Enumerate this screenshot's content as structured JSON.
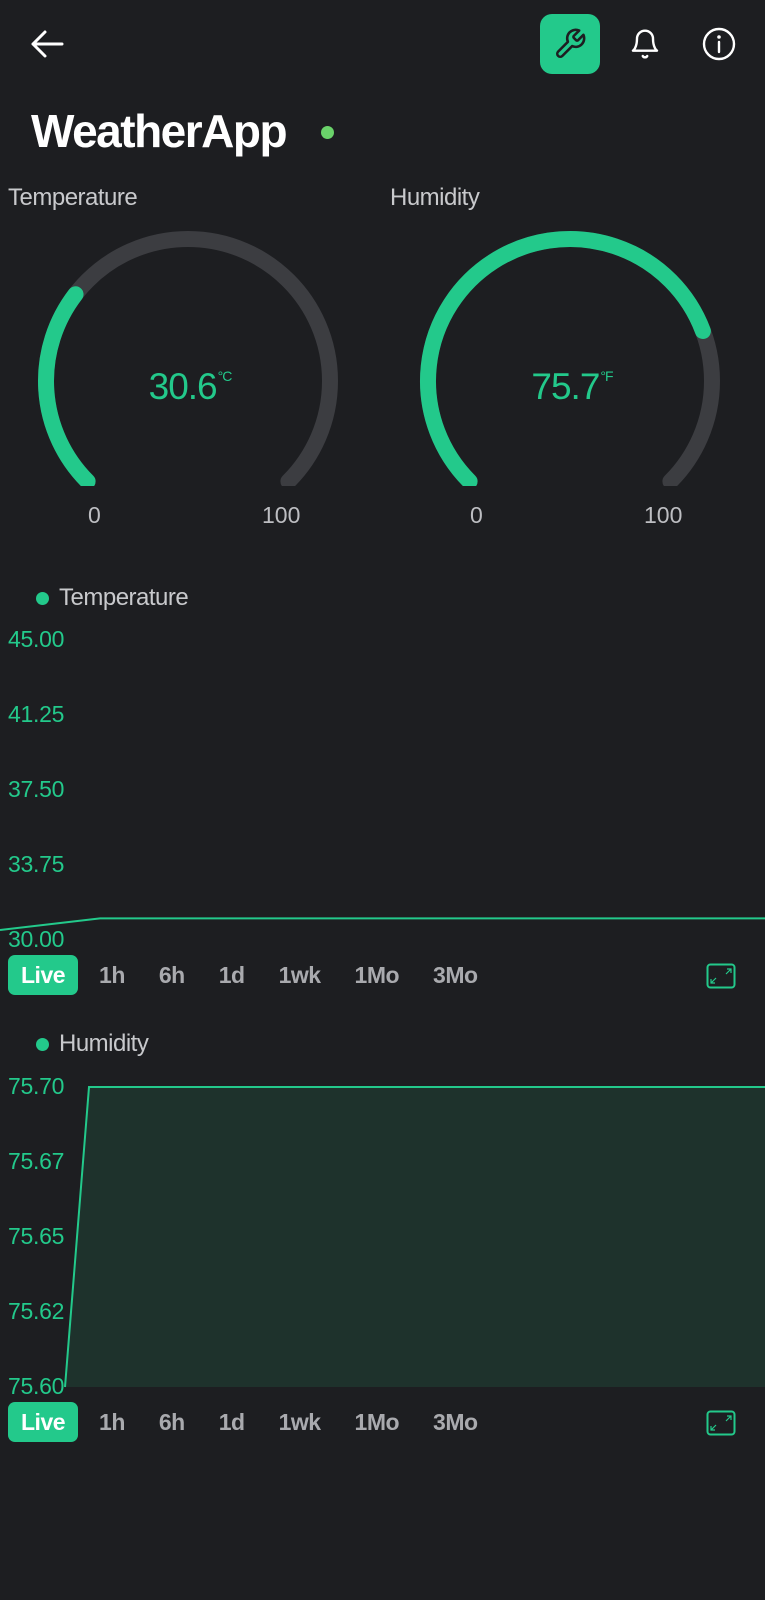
{
  "header": {
    "back_icon": "arrow-left-icon",
    "wrench_icon": "wrench-icon",
    "bell_icon": "bell-icon",
    "info_icon": "info-icon",
    "accent_color": "#23c98b"
  },
  "device": {
    "name": "WeatherApp",
    "status_color": "#6ad26a"
  },
  "gauges": [
    {
      "label": "Temperature",
      "value": "30.6",
      "unit": "°C",
      "min": "0",
      "max": "100",
      "fraction": 0.306
    },
    {
      "label": "Humidity",
      "value": "75.7",
      "unit": "°F",
      "min": "0",
      "max": "100",
      "fraction": 0.757
    }
  ],
  "charts": [
    {
      "legend": "Temperature",
      "y_ticks": [
        "45.00",
        "41.25",
        "37.50",
        "33.75",
        "30.00"
      ],
      "ylim": [
        30.0,
        45.0
      ],
      "series_values": [
        30.0,
        30.6,
        30.6
      ],
      "ranges": [
        "Live",
        "1h",
        "6h",
        "1d",
        "1wk",
        "1Mo",
        "3Mo"
      ],
      "active_range": "Live"
    },
    {
      "legend": "Humidity",
      "y_ticks": [
        "75.70",
        "75.67",
        "75.65",
        "75.62",
        "75.60"
      ],
      "ylim": [
        75.6,
        75.7
      ],
      "series_values": [
        75.6,
        75.7,
        75.7
      ],
      "ranges": [
        "Live",
        "1h",
        "6h",
        "1d",
        "1wk",
        "1Mo",
        "3Mo"
      ],
      "active_range": "Live"
    }
  ]
}
